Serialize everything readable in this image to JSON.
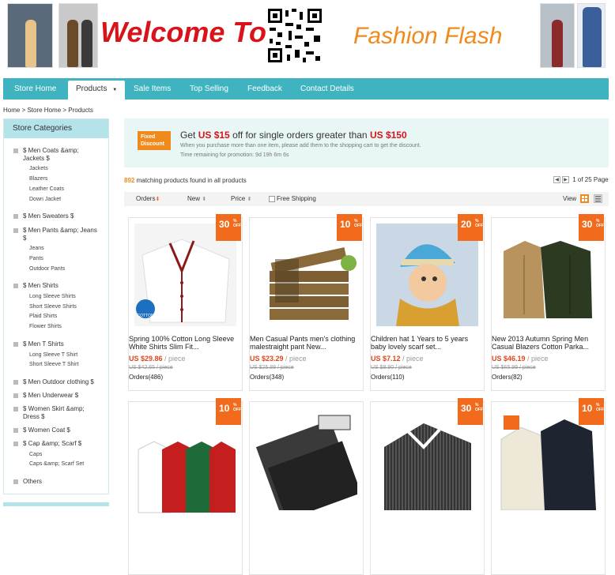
{
  "banner": {
    "welcome": "Welcome To",
    "fashion": "Fashion Flash"
  },
  "nav": {
    "items": [
      "Store Home",
      "Products",
      "Sale Items",
      "Top Selling",
      "Feedback",
      "Contact Details"
    ],
    "active": "Products"
  },
  "breadcrumb": "Home > Store Home > Products",
  "sidebar": {
    "title": "Store Categories",
    "categories": [
      {
        "label": "$ Men Coats &amp; Jackets $",
        "subs": [
          "Jackets",
          "Blazers",
          "Leather Coats",
          "Down Jacket"
        ]
      },
      {
        "label": "$ Men Sweaters $",
        "subs": []
      },
      {
        "label": "$ Men Pants &amp; Jeans $",
        "subs": [
          "Jeans",
          "Pants",
          "Outdoor Pants"
        ]
      },
      {
        "label": "$ Men Shirts",
        "subs": [
          "Long Sleeve Shirts",
          "Short Sleeve Shirts",
          "Plaid Shirts",
          "Flower Shirts"
        ]
      },
      {
        "label": "$ Men T Shirts",
        "subs": [
          "Long Sleeve T Shirt",
          "Short Sleeve T Shirt"
        ]
      },
      {
        "label": "$ Men Outdoor clothing $",
        "subs": []
      },
      {
        "label": "$ Men Underwear $",
        "subs": []
      },
      {
        "label": "$ Women Skirt &amp; Dress $",
        "subs": []
      },
      {
        "label": "$ Women Coat $",
        "subs": []
      },
      {
        "label": "$ Cap &amp; Scarf $",
        "subs": [
          "Caps",
          "Caps &amp; Scarf Set"
        ]
      },
      {
        "label": "Others",
        "subs": []
      }
    ]
  },
  "promo": {
    "badge_line1": "Fixed",
    "badge_line2": "Discount",
    "text_pre": "Get",
    "amount": "US $15",
    "text_mid": "off for single orders greater than",
    "threshold": "US $150",
    "line2": "When you purchase more than one item, please add them to the shopping cart to get the discount.",
    "line3": "Time remaining for promotion: 9d 19h 6m 6s"
  },
  "results": {
    "count": "892",
    "text": "matching products found in all products",
    "pager": "1 of 25 Page"
  },
  "sort": {
    "orders": "Orders",
    "new": "New",
    "price": "Price",
    "free_shipping": "Free Shipping",
    "view": "View"
  },
  "products": [
    {
      "discount": "30",
      "title": "Spring 100% Cotton Long Sleeve White Shirts Slim Fit...",
      "price": "US $29.86",
      "unit": "/ piece",
      "old": "US $42.65 / piece",
      "orders": "Orders(486)"
    },
    {
      "discount": "10",
      "title": "Men Casual Pants men's clothing malestraight pant New...",
      "price": "US $23.29",
      "unit": "/ piece",
      "old": "US $25.88 / piece",
      "orders": "Orders(348)"
    },
    {
      "discount": "20",
      "title": "Children hat 1 Years to 5 years baby lovely scarf set...",
      "price": "US $7.12",
      "unit": "/ piece",
      "old": "US $8.90 / piece",
      "orders": "Orders(110)"
    },
    {
      "discount": "30",
      "title": "New 2013 Autumn Spring Men Casual Blazers Cotton Parka...",
      "price": "US $46.19",
      "unit": "/ piece",
      "old": "US $65.99 / piece",
      "orders": "Orders(82)"
    },
    {
      "discount": "10",
      "title": "",
      "price": "",
      "unit": "",
      "old": "",
      "orders": ""
    },
    {
      "discount": "",
      "title": "",
      "price": "",
      "unit": "",
      "old": "",
      "orders": ""
    },
    {
      "discount": "30",
      "title": "",
      "price": "",
      "unit": "",
      "old": "",
      "orders": ""
    },
    {
      "discount": "10",
      "title": "",
      "price": "",
      "unit": "",
      "old": "",
      "orders": ""
    }
  ],
  "off_label": "% OFF",
  "colors": {
    "teal": "#3fb4c0",
    "orange": "#f26a1b",
    "red": "#d8141a"
  }
}
